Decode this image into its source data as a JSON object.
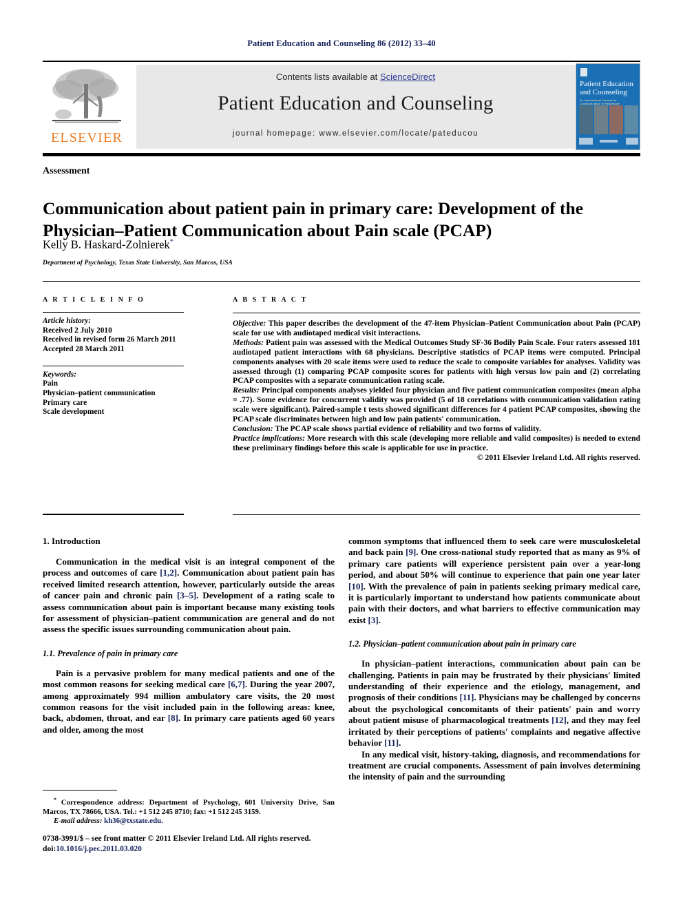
{
  "running_head": "Patient Education and Counseling 86 (2012) 33–40",
  "masthead": {
    "contents_prefix": "Contents lists available at ",
    "sciencedirect": "ScienceDirect",
    "journal_title": "Patient Education and Counseling",
    "homepage": "journal homepage: www.elsevier.com/locate/pateducou",
    "publisher_wordmark": "ELSEVIER",
    "cover_title": "Patient Education and Counseling",
    "cover_subtitle": "An International Journal for Communication in Healthcare",
    "link_color": "#2b3a94",
    "band_color": "#e8e8e8",
    "elsevier_orange": "#f07c22",
    "cover_blue": "#1b6fb5"
  },
  "article": {
    "kicker": "Assessment",
    "title": "Communication about patient pain in primary care: Development of the Physician–Patient Communication about Pain scale (PCAP)",
    "author": "Kelly B. Haskard-Zolnierek",
    "author_marker": "*",
    "affiliation": "Department of Psychology, Texas State University, San Marcos, USA"
  },
  "article_info": {
    "heading": "A R T I C L E   I N F O",
    "history_label": "Article history:",
    "history": [
      "Received 2 July 2010",
      "Received in revised form 26 March 2011",
      "Accepted 28 March 2011"
    ],
    "keywords_label": "Keywords:",
    "keywords": [
      "Pain",
      "Physician–patient communication",
      "Primary care",
      "Scale development"
    ]
  },
  "abstract": {
    "heading": "A B S T R A C T",
    "objective_label": "Objective:",
    "objective_text": " This paper describes the development of the 47-item Physician–Patient Communication about Pain (PCAP) scale for use with audiotaped medical visit interactions.",
    "methods_label": "Methods:",
    "methods_text": " Patient pain was assessed with the Medical Outcomes Study SF-36 Bodily Pain Scale. Four raters assessed 181 audiotaped patient interactions with 68 physicians. Descriptive statistics of PCAP items were computed. Principal components analyses with 20 scale items were used to reduce the scale to composite variables for analyses. Validity was assessed through (1) comparing PCAP composite scores for patients with high versus low pain and (2) correlating PCAP composites with a separate communication rating scale.",
    "results_label": "Results:",
    "results_text": " Principal components analyses yielded four physician and five patient communication composites (mean alpha = .77). Some evidence for concurrent validity was provided (5 of 18 correlations with communication validation rating scale were significant). Paired-sample t tests showed significant differences for 4 patient PCAP composites, showing the PCAP scale discriminates between high and low pain patients' communication.",
    "conclusion_label": "Conclusion:",
    "conclusion_text": " The PCAP scale shows partial evidence of reliability and two forms of validity.",
    "implications_label": "Practice implications:",
    "implications_text": " More research with this scale (developing more reliable and valid composites) is needed to extend these preliminary findings before this scale is applicable for use in practice.",
    "copyright": "© 2011 Elsevier Ireland Ltd. All rights reserved."
  },
  "body": {
    "section1_heading": "1. Introduction",
    "section1_p1_a": "Communication in the medical visit is an integral component of the process and outcomes of care ",
    "section1_p1_r1": "[1,2]",
    "section1_p1_b": ". Communication about patient pain has received limited research attention, however, particularly outside the areas of cancer pain and chronic pain ",
    "section1_p1_r2": "[3–5]",
    "section1_p1_c": ". Development of a rating scale to assess communication about pain is important because many existing tools for assessment of physician–patient communication are general and do not assess the specific issues surrounding communication about pain.",
    "section11_heading": "1.1. Prevalence of pain in primary care",
    "section11_p1_a": "Pain is a pervasive problem for many medical patients and one of the most common reasons for seeking medical care ",
    "section11_p1_r1": "[6,7]",
    "section11_p1_b": ". During the year 2007, among approximately 994 million ambulatory care visits, the 20 most common reasons for the visit included pain in the following areas: knee, back, abdomen, throat, and ear ",
    "section11_p1_r2": "[8]",
    "section11_p1_c": ". In primary care patients aged 60 years and older, among the most",
    "right_p1_a": "common symptoms that influenced them to seek care were musculoskeletal and back pain ",
    "right_p1_r1": "[9]",
    "right_p1_b": ". One cross-national study reported that as many as 9% of primary care patients will experience persistent pain over a year-long period, and about 50% will continue to experience that pain one year later ",
    "right_p1_r2": "[10]",
    "right_p1_c": ". With the prevalence of pain in patients seeking primary medical care, it is particularly important to understand how patients communicate about pain with their doctors, and what barriers to effective communication may exist ",
    "right_p1_r3": "[3]",
    "right_p1_d": ".",
    "section12_heading": "1.2. Physician–patient communication about pain in primary care",
    "section12_p1_a": "In physician–patient interactions, communication about pain can be challenging. Patients in pain may be frustrated by their physicians' limited understanding of their experience and the etiology, management, and prognosis of their conditions ",
    "section12_p1_r1": "[11]",
    "section12_p1_b": ". Physicians may be challenged by concerns about the psychological concomitants of their patients' pain and worry about patient misuse of pharmacological treatments ",
    "section12_p1_r2": "[12]",
    "section12_p1_c": ", and they may feel irritated by their perceptions of patients' complaints and negative affective behavior ",
    "section12_p1_r3": "[11]",
    "section12_p1_d": ".",
    "section12_p2": "In any medical visit, history-taking, diagnosis, and recommendations for treatment are crucial components. Assessment of pain involves determining the intensity of pain and the surrounding"
  },
  "footnote": {
    "star": "*",
    "correspondence": " Correspondence address: Department of Psychology, 601 University Drive, San Marcos, TX 78666, USA. Tel.: +1 512 245 8710; fax: +1 512 245 3159.",
    "email_label": "E-mail address:",
    "email": " kh36@txstate.edu."
  },
  "colophon": {
    "issn_line": "0738-3991/$ – see front matter © 2011 Elsevier Ireland Ltd. All rights reserved.",
    "doi_prefix": "doi:",
    "doi": "10.1016/j.pec.2011.03.020"
  }
}
